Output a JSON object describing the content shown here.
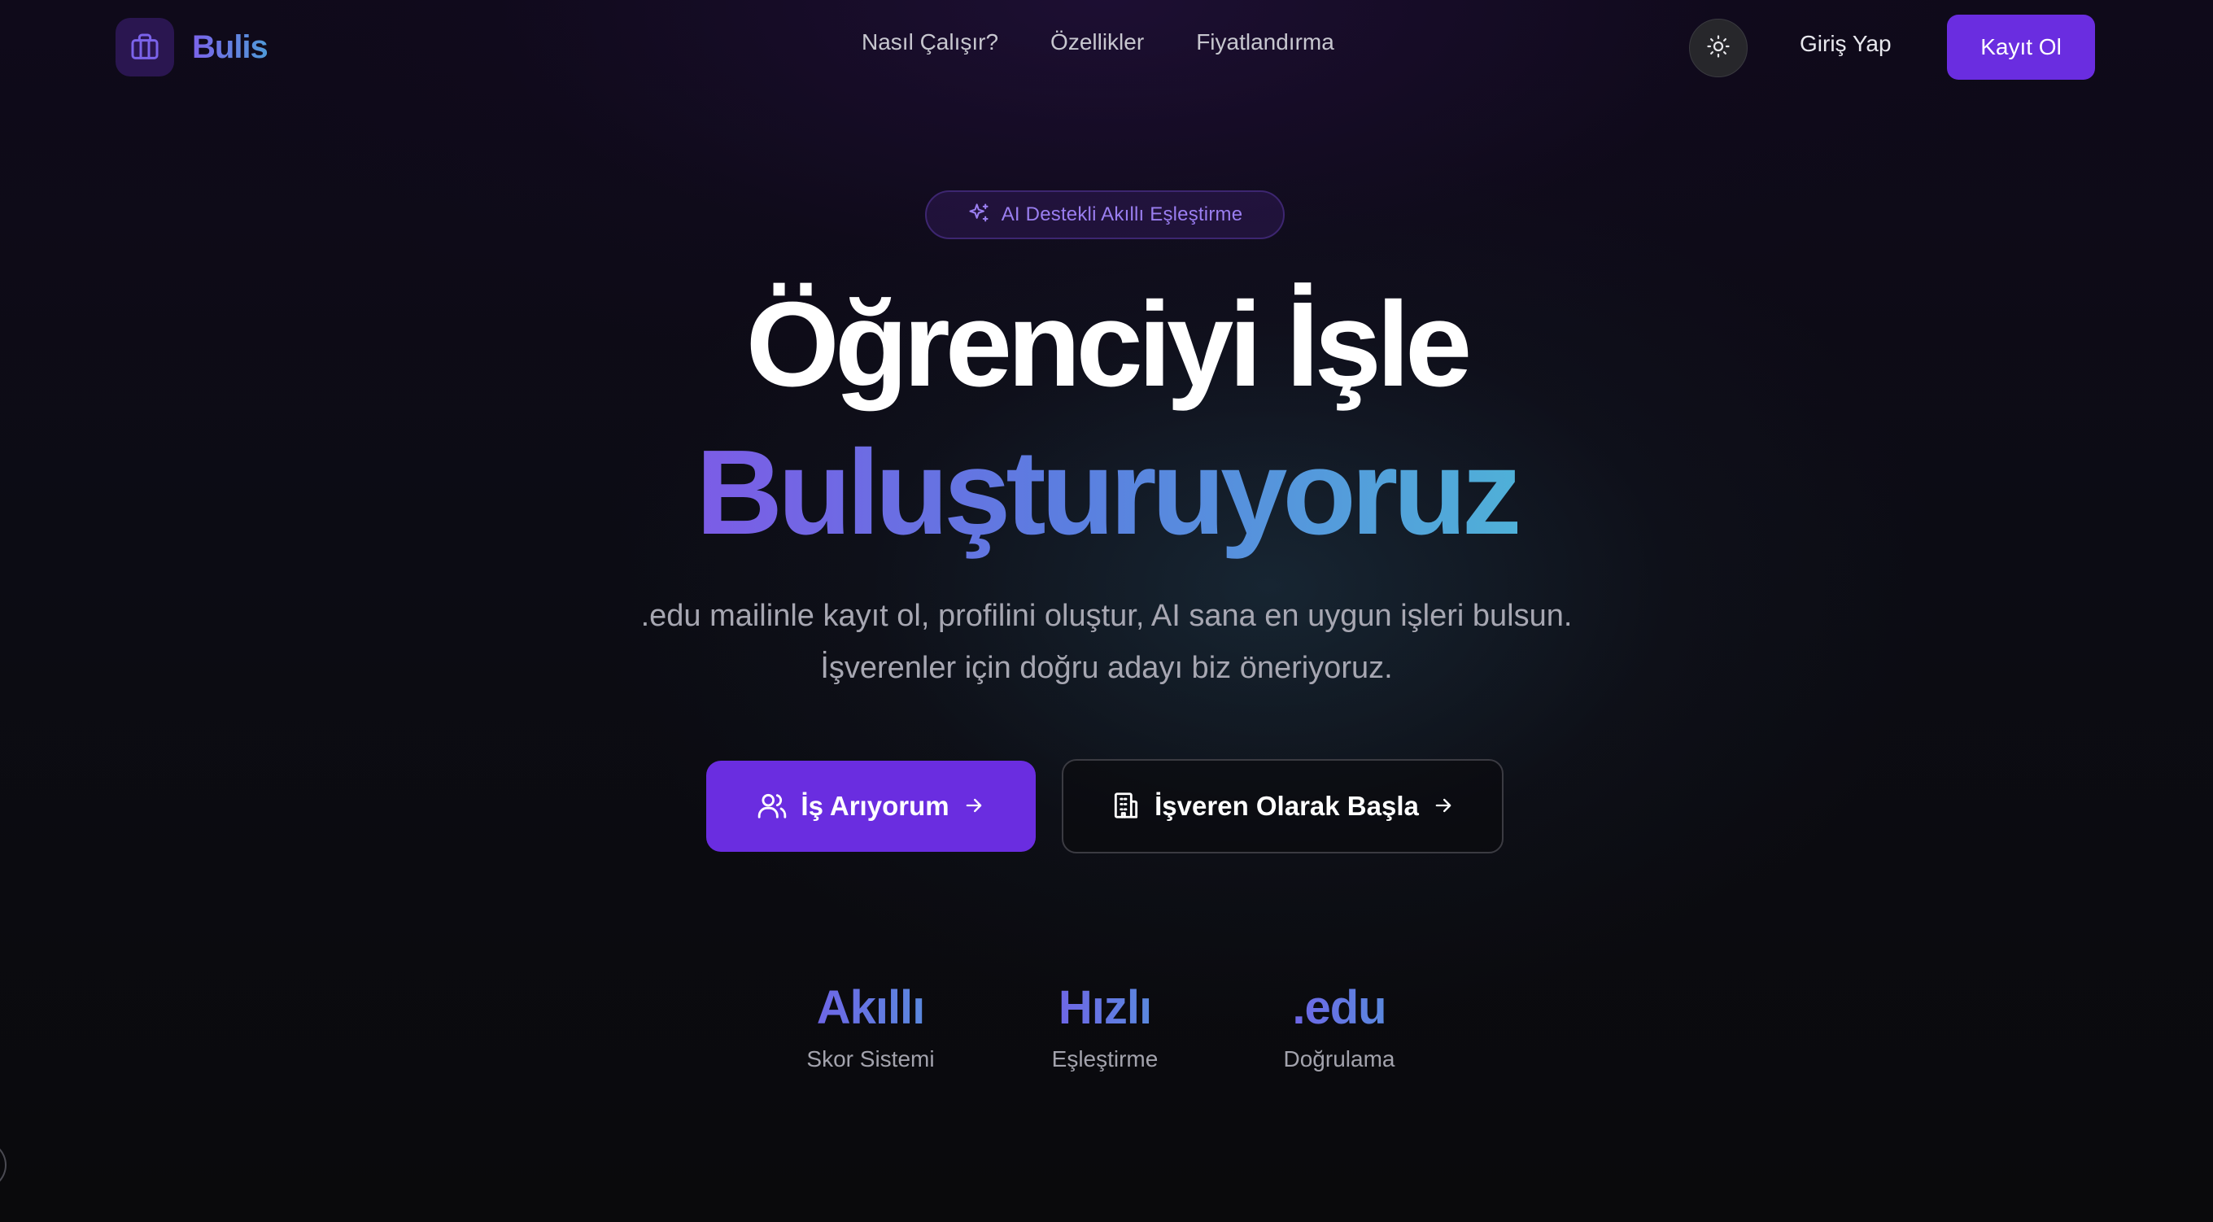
{
  "nav": {
    "logo_text": "Bulis",
    "links": [
      "Nasıl Çalışır?",
      "Özellikler",
      "Fiyatlandırma"
    ],
    "login_label": "Giriş Yap",
    "signup_label": "Kayıt Ol"
  },
  "hero": {
    "badge": "AI Destekli Akıllı Eşleştirme",
    "title_line1": "Öğrenciyi İşle",
    "title_line2": "Buluşturuyoruz",
    "subtitle_line1": ".edu mailinle kayıt ol, profilini oluştur, AI sana en uygun işleri bulsun.",
    "subtitle_line2": "İşverenler için doğru adayı biz öneriyoruz.",
    "cta_primary": "İş Arıyorum",
    "cta_secondary": "İşveren Olarak Başla"
  },
  "stats": [
    {
      "value": "Akıllı",
      "label": "Skor Sistemi"
    },
    {
      "value": "Hızlı",
      "label": "Eşleştirme"
    },
    {
      "value": ".edu",
      "label": "Doğrulama"
    }
  ],
  "icons": {
    "logo": "briefcase-icon",
    "theme": "sun-icon",
    "badge": "sparkles-icon",
    "cta_primary": "users-icon",
    "cta_secondary": "building-icon",
    "arrow": "arrow-right-icon"
  },
  "colors": {
    "accent": "#6a2de0",
    "gradient_start": "#7c5ce6",
    "gradient_end": "#4fb0d8",
    "background": "#0a0a0c"
  }
}
